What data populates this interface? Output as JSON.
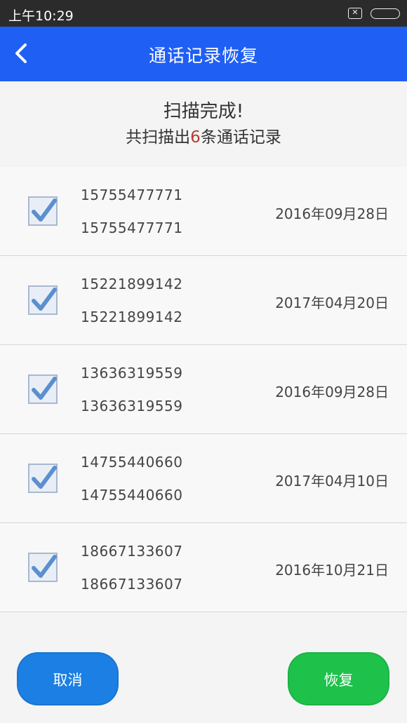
{
  "status_bar": {
    "time": "上午10:29",
    "sim_glyph": "✕"
  },
  "header": {
    "title": "通话记录恢复"
  },
  "summary": {
    "title": "扫描完成!",
    "count_prefix": "共扫描出",
    "count": "6",
    "count_suffix": "条通话记录"
  },
  "records": [
    {
      "number": "15755477771",
      "number_repeat": "15755477771",
      "date": "2016年09月28日",
      "checked": true
    },
    {
      "number": "15221899142",
      "number_repeat": "15221899142",
      "date": "2017年04月20日",
      "checked": true
    },
    {
      "number": "13636319559",
      "number_repeat": "13636319559",
      "date": "2016年09月28日",
      "checked": true
    },
    {
      "number": "14755440660",
      "number_repeat": "14755440660",
      "date": "2017年04月10日",
      "checked": true
    },
    {
      "number": "18667133607",
      "number_repeat": "18667133607",
      "date": "2016年10月21日",
      "checked": true
    }
  ],
  "buttons": {
    "cancel": "取消",
    "restore": "恢复"
  },
  "colors": {
    "app_bar": "#1f5ff3",
    "cancel": "#1b7fe3",
    "restore": "#1ec24a",
    "count_accent": "#b63a36"
  }
}
